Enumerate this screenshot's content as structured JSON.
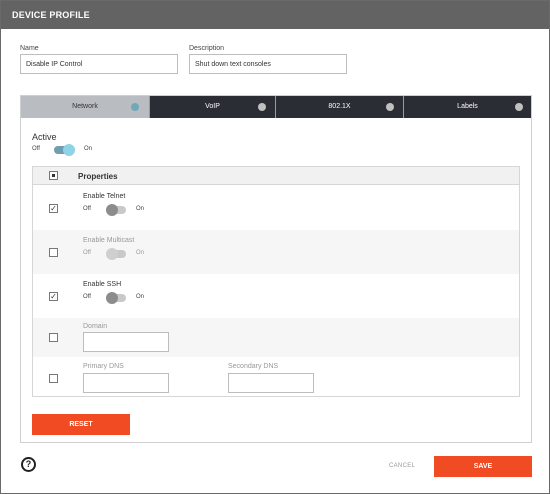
{
  "window": {
    "title": "DEVICE PROFILE"
  },
  "form": {
    "name_label": "Name",
    "name_value": "Disable IP Control",
    "description_label": "Description",
    "description_value": "Shut down text consoles"
  },
  "tabs": [
    {
      "label": "Network",
      "active": true
    },
    {
      "label": "VoIP",
      "active": false
    },
    {
      "label": "802.1X",
      "active": false
    },
    {
      "label": "Labels",
      "active": false
    }
  ],
  "active_toggle": {
    "label": "Active",
    "off": "Off",
    "on": "On",
    "state": "on"
  },
  "properties": {
    "header": "Properties",
    "rows": [
      {
        "label": "Enable Telnet",
        "checked": true,
        "off": "Off",
        "on": "On",
        "state": "off",
        "enabled": true
      },
      {
        "label": "Enable Multicast",
        "checked": false,
        "off": "Off",
        "on": "On",
        "state": "off",
        "enabled": false
      },
      {
        "label": "Enable SSH",
        "checked": true,
        "off": "Off",
        "on": "On",
        "state": "off",
        "enabled": true
      },
      {
        "label": "Domain",
        "checked": false,
        "value": "",
        "enabled": false
      },
      {
        "primary_label": "Primary DNS",
        "secondary_label": "Secondary DNS",
        "checked": false,
        "primary_value": "",
        "secondary_value": "",
        "enabled": false
      }
    ]
  },
  "buttons": {
    "reset": "RESET",
    "cancel": "CANCEL",
    "save": "SAVE"
  },
  "help": {
    "glyph": "?"
  },
  "colors": {
    "accent": "#f04b22",
    "titlebar": "#636363",
    "tabbar": "#2b2d34",
    "toggle_on": "#8fd3e6"
  }
}
